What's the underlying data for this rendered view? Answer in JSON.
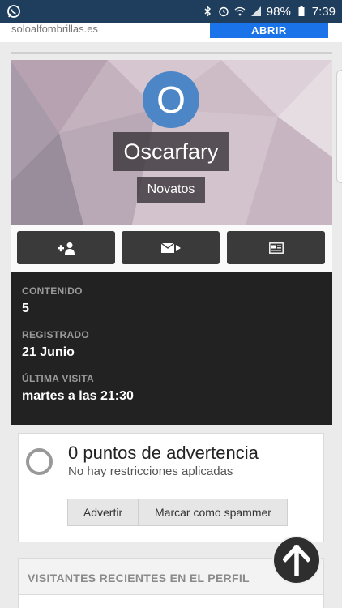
{
  "status_bar": {
    "battery_percent": "98%",
    "time": "7:39"
  },
  "ad": {
    "url": "soloalfombrillas.es",
    "button_label": "ABRIR"
  },
  "profile": {
    "avatar_letter": "O",
    "username": "Oscarfary",
    "rank": "Novatos"
  },
  "actions": [
    "follow",
    "message",
    "profile-posts"
  ],
  "stats": {
    "content_label": "CONTENIDO",
    "content_value": "5",
    "registered_label": "REGISTRADO",
    "registered_value": "21 Junio",
    "last_visit_label": "ÚLTIMA VISITA",
    "last_visit_value": "martes a las 21:30"
  },
  "warnings": {
    "title": "0 puntos de advertencia",
    "subtitle": "No hay restricciones aplicadas",
    "warn_button": "Advertir",
    "spam_button": "Marcar como spammer"
  },
  "visitors": {
    "title": "VISITANTES RECIENTES EN EL PERFIL"
  },
  "colors": {
    "status_bar": "#1f3d5c",
    "ad_button": "#1a73e8",
    "avatar": "#4d86c6",
    "stats_bg": "#222222"
  }
}
